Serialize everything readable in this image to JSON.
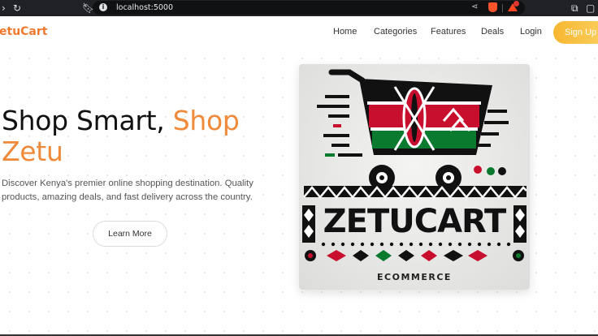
{
  "browser": {
    "url": "localhost:5000",
    "icons": [
      "back-icon",
      "reload-icon",
      "bookmark-icon",
      "info-icon",
      "share-icon",
      "brave-shield-icon",
      "brave-rewards-icon",
      "extensions-icon",
      "window-icon"
    ]
  },
  "nav": {
    "logo": "etuCart",
    "links": [
      "Home",
      "Categories",
      "Features",
      "Deals",
      "Login"
    ],
    "signup": "Sign Up"
  },
  "hero": {
    "headline_part1": "Shop Smart, ",
    "headline_accent1": "Shop",
    "headline_accent2": "Zetu",
    "description": "Discover Kenya's premier online shopping destination. Quality products, amazing deals, and fast delivery across the country.",
    "cta": "Learn More",
    "colors": {
      "accent": "#ef8a3a",
      "signup_gradient_start": "#f7b731"
    }
  },
  "hero_image": {
    "brand_text": "ZETUCART",
    "subtitle": "ECOMMERCE",
    "colors": {
      "black": "#111111",
      "red": "#c8102e",
      "green": "#0a7a2f",
      "white": "#ffffff"
    }
  }
}
